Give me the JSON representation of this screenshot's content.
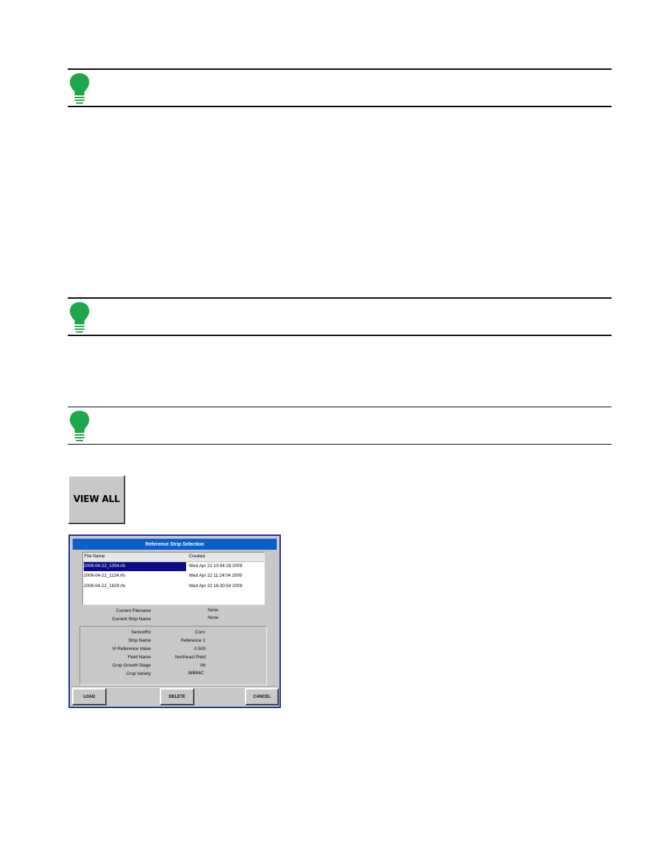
{
  "view_all_button": {
    "label": "VIEW ALL"
  },
  "dialog": {
    "title": "Reference Strip Selection",
    "columns": {
      "file_name": "File Name",
      "created": "Created"
    },
    "files": [
      {
        "name": "2009-04-22_1054.rfs",
        "created": "Wed Apr 22 10:54:28 2009",
        "selected": true
      },
      {
        "name": "2009-04-22_1124.rfs",
        "created": "Wed Apr 22 11:24:04 2009",
        "selected": false
      },
      {
        "name": "2009-04-22_1629.rfs",
        "created": "Wed Apr 22 16:30:54 2009",
        "selected": false
      }
    ],
    "current": [
      {
        "label": "Current Filename",
        "value": "None"
      },
      {
        "label": "Current Strip Name",
        "value": "None"
      }
    ],
    "details": [
      {
        "label": "SensorRx",
        "value": "Corn"
      },
      {
        "label": "Strip Name",
        "value": "Reference 1"
      },
      {
        "label": "VI Reference Value",
        "value": "0.500"
      },
      {
        "label": "Field Name",
        "value": "Northeast Field"
      },
      {
        "label": "Crop Growth Stage",
        "value": "V6"
      },
      {
        "label": "Crop Variety",
        "value": "38B84C"
      }
    ],
    "buttons": {
      "load": "LOAD",
      "delete": "DELETE",
      "cancel": "CANCEL"
    }
  },
  "colors": {
    "bulb": "#1ea64a",
    "title_bar": "#0b5fc9",
    "selection": "#0a0a8a",
    "dialog_border": "#1c2d8c"
  }
}
